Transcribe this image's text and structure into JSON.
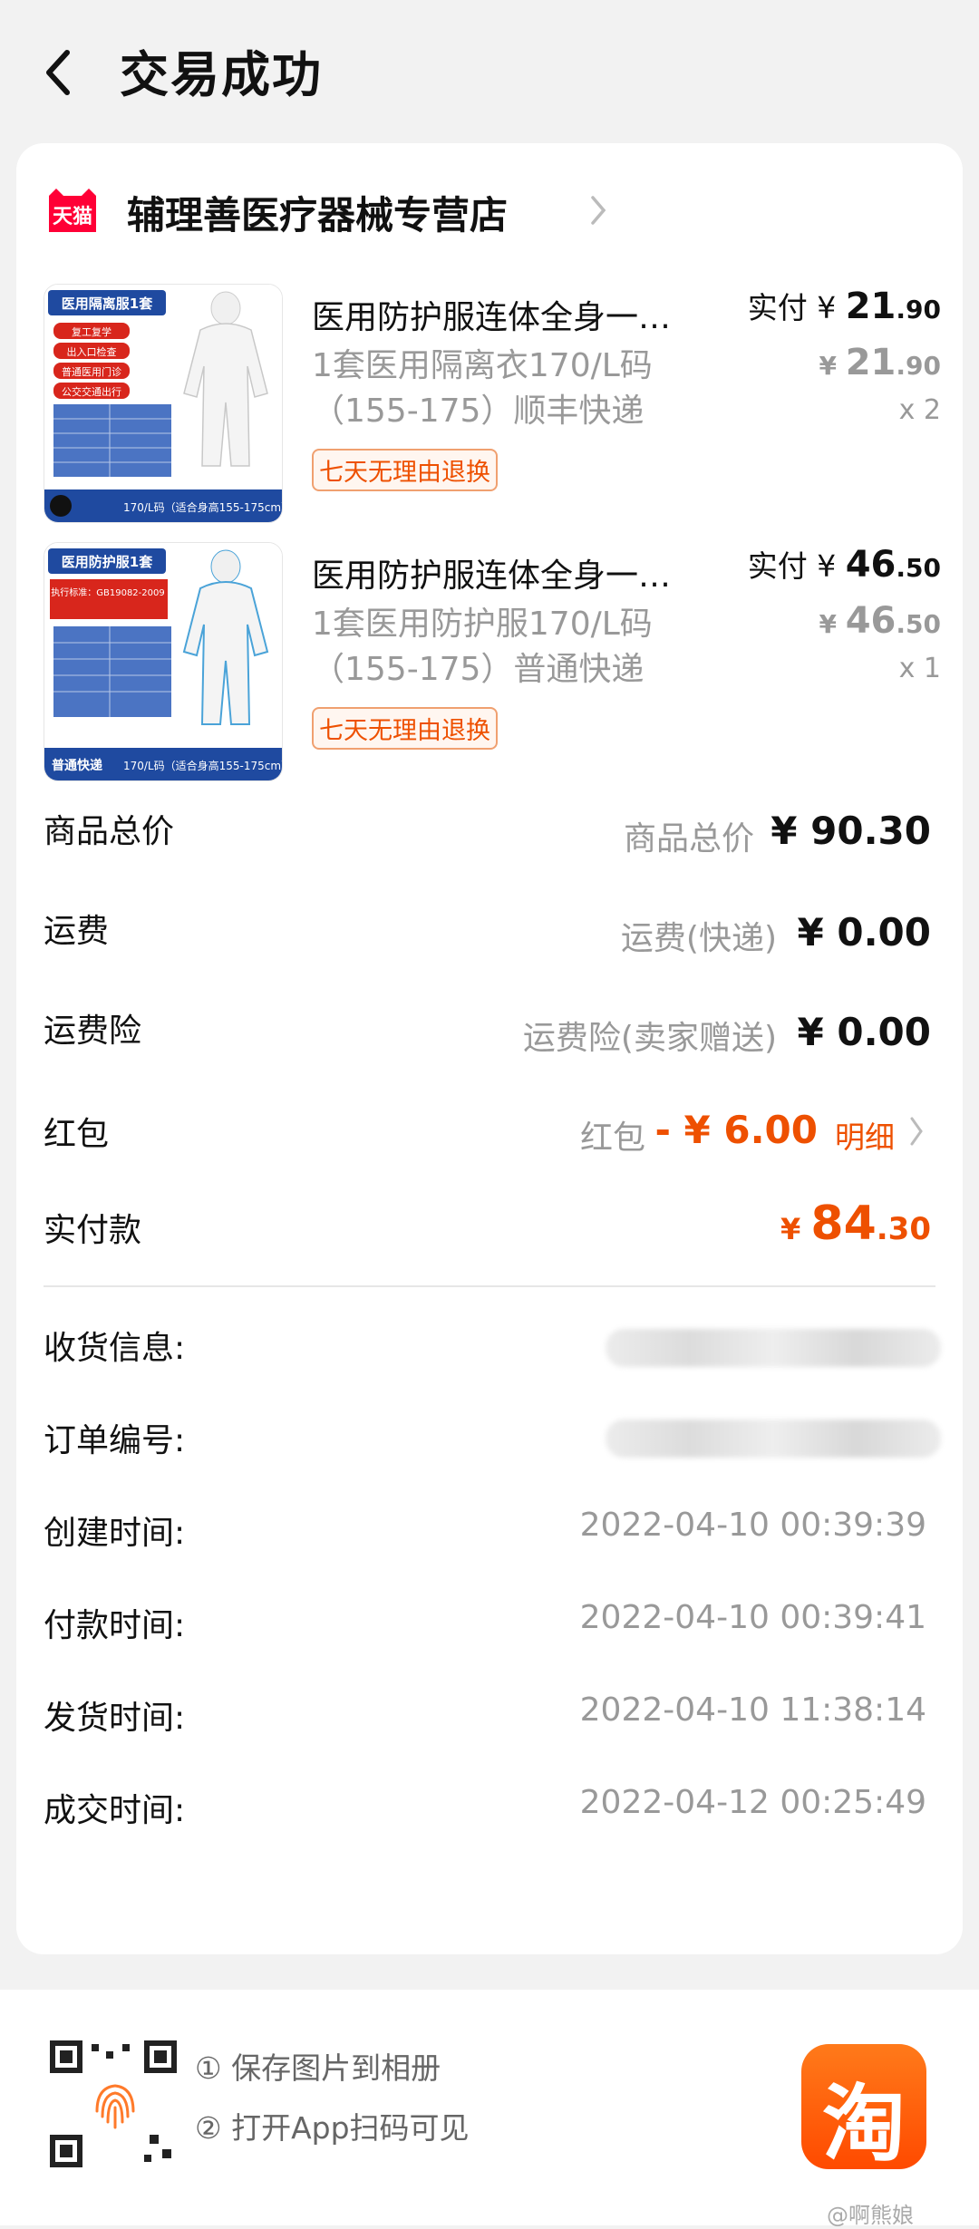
{
  "header": {
    "title": "交易成功"
  },
  "store": {
    "logo_text": "天猫",
    "name": "辅理善医疗器械专营店"
  },
  "items": [
    {
      "title": "医用防护服连体全身一…",
      "sku_line1": "1套医用隔离衣170/L码",
      "sku_line2": "（155-175）顺丰快递",
      "tag": "七天无理由退换",
      "paid_label": "实付 ¥ ",
      "paid_int": "21",
      "paid_dec": ".90",
      "orig_symbol": "¥ ",
      "orig_int": "21",
      "orig_dec": ".90",
      "qty": "x 2",
      "thumb_title": "医用隔离服1套",
      "thumb_bullets": [
        "复工复学",
        "出入口检查",
        "普通医用门诊",
        "公交交通出行"
      ],
      "thumb_footer": "170/L码（适合身高155-175cm）"
    },
    {
      "title": "医用防护服连体全身一…",
      "sku_line1": "1套医用防护服170/L码",
      "sku_line2": "（155-175）普通快递",
      "tag": "七天无理由退换",
      "paid_label": "实付 ¥ ",
      "paid_int": "46",
      "paid_dec": ".50",
      "orig_symbol": "¥ ",
      "orig_int": "46",
      "orig_dec": ".50",
      "qty": "x 1",
      "thumb_title": "医用防护服1套",
      "thumb_bullets": [
        "执行标准：GB19082-2009"
      ],
      "thumb_footer": "170/L码（适合身高155-175cm）",
      "thumb_badge": "普通快递"
    }
  ],
  "summary": {
    "goods_label": "商品总价",
    "goods_sub": "商品总价",
    "goods_val": "¥ 90.30",
    "ship_label": "运费",
    "ship_sub": "运费(快递)",
    "ship_val": "¥ 0.00",
    "ins_label": "运费险",
    "ins_sub": "运费险(卖家赠送)",
    "ins_val": "¥ 0.00",
    "rp_label": "红包",
    "rp_sub": "红包",
    "rp_val": "- ¥ 6.00",
    "rp_detail": "明细",
    "pay_label": "实付款",
    "pay_symbol": "¥ ",
    "pay_int": "84",
    "pay_dec": ".30"
  },
  "info": {
    "address_label": "收货信息:",
    "order_label": "订单编号:",
    "created_label": "创建时间:",
    "created_val": "2022-04-10 00:39:39",
    "paid_label": "付款时间:",
    "paid_val": "2022-04-10 00:39:41",
    "shipped_label": "发货时间:",
    "shipped_val": "2022-04-10 11:38:14",
    "done_label": "成交时间:",
    "done_val": "2022-04-12 00:25:49"
  },
  "footer": {
    "hint1": "① 保存图片到相册",
    "hint2": "② 打开App扫码可见",
    "app_glyph": "淘",
    "watermark": "@啊熊娘"
  },
  "colors": {
    "accent": "#ee5000",
    "muted": "#999999",
    "card": "#ffffff",
    "bg": "#f2f2f2"
  }
}
